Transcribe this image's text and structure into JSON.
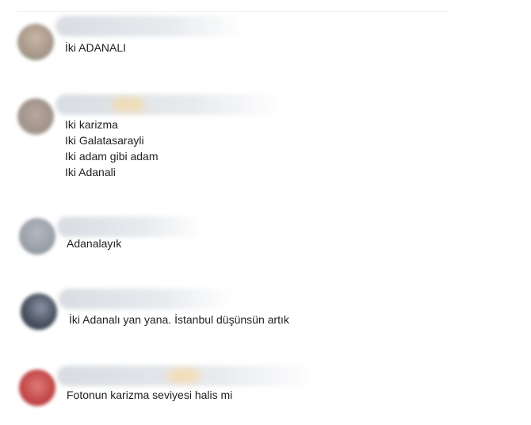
{
  "replies": [
    {
      "avatar_color": "#b6a89a",
      "lines": [
        "İki ADANALI"
      ]
    },
    {
      "avatar_color": "#a89990",
      "lines": [
        "Iki karizma",
        "Iki Galatasarayli",
        "Iki adam gibi adam",
        "Iki Adanali"
      ]
    },
    {
      "avatar_color": "#9aa0a8",
      "lines": [
        "Adanalayık"
      ]
    },
    {
      "avatar_color": "#5a6270",
      "lines": [
        "İki Adanalı yan yana. İstanbul düşünsün artık"
      ]
    },
    {
      "avatar_color": "#c44a4a",
      "lines": [
        "Fotonun karizma seviyesi halis mi"
      ]
    }
  ]
}
